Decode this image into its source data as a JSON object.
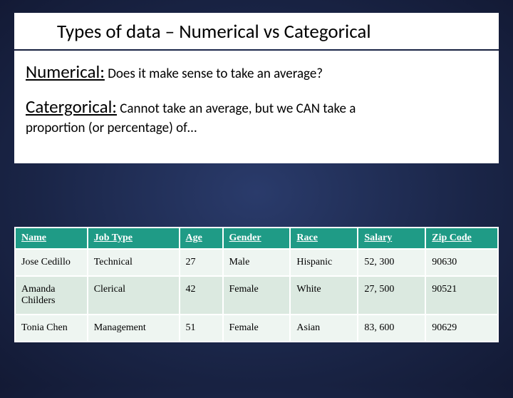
{
  "title": "Types of data – Numerical vs Categorical",
  "numerical": {
    "lead": "Numerical:",
    "rest": " Does it make sense to take an average?"
  },
  "categorical": {
    "lead": "Catergorical:",
    "rest": " Cannot take an average, but we CAN take a",
    "cont": "proportion (or percentage) of…"
  },
  "table": {
    "headers": [
      "Name",
      "Job Type",
      "Age",
      "Gender",
      "Race",
      "Salary",
      "Zip Code"
    ],
    "rows": [
      [
        "Jose Cedillo",
        "Technical",
        "27",
        "Male",
        "Hispanic",
        "52, 300",
        "90630"
      ],
      [
        "Amanda Childers",
        "Clerical",
        "42",
        "Female",
        "White",
        "27, 500",
        "90521"
      ],
      [
        "Tonia Chen",
        "Management",
        "51",
        "Female",
        "Asian",
        "83, 600",
        "90629"
      ]
    ]
  }
}
